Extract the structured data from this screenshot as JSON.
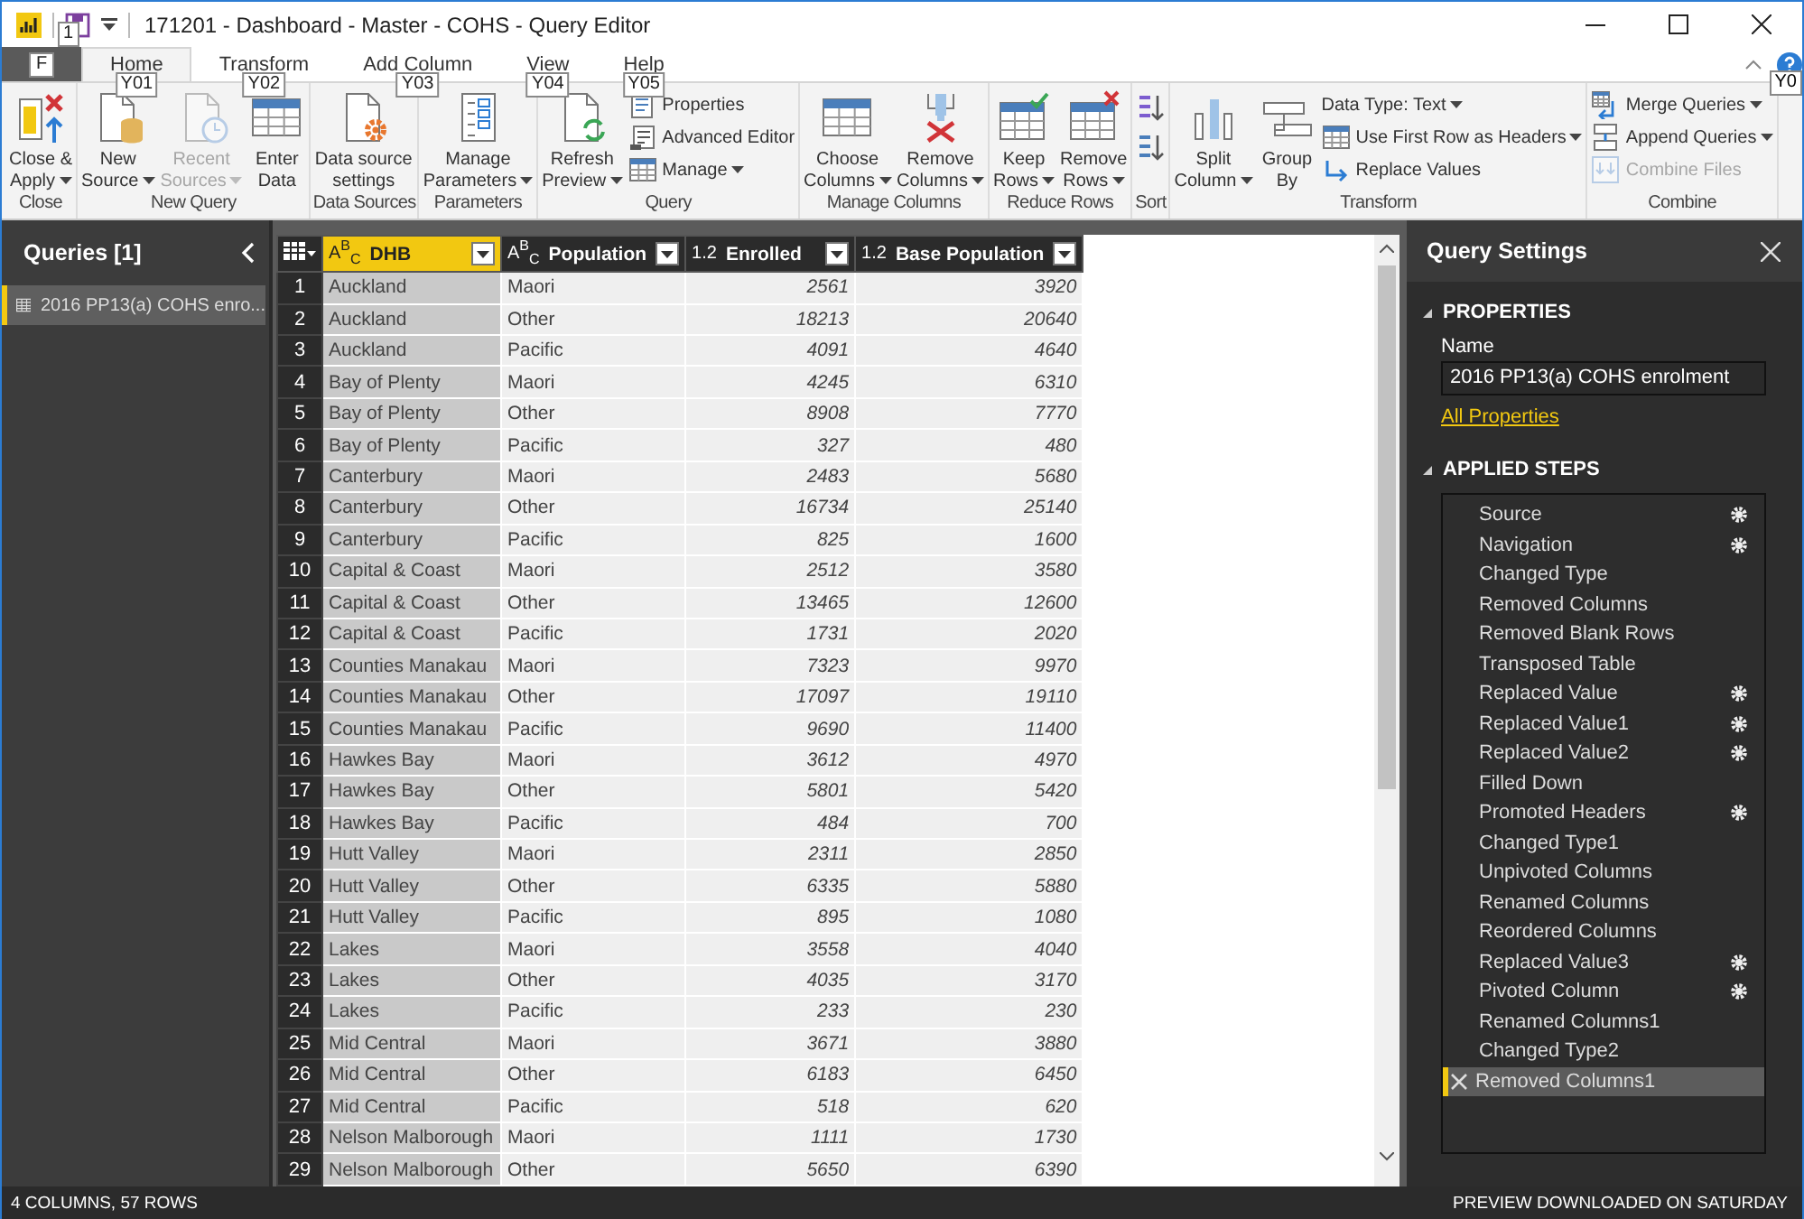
{
  "window": {
    "title": "171201 - Dashboard - Master - COHS - Query Editor",
    "save_keytip": "1"
  },
  "tabs": [
    {
      "label": "F",
      "kind": "file",
      "selected": false
    },
    {
      "label": "Home",
      "kind": "tab",
      "keytip": "Y01",
      "selected": true
    },
    {
      "label": "Transform",
      "kind": "tab",
      "keytip": "Y02",
      "selected": false
    },
    {
      "label": "Add Column",
      "kind": "tab",
      "keytip": "Y03",
      "selected": false
    },
    {
      "label": "View",
      "kind": "tab",
      "keytip": "Y04",
      "selected": false
    },
    {
      "label": "Help",
      "kind": "tab",
      "keytip": "Y05",
      "selected": false
    }
  ],
  "help_keytip": "Y0",
  "ribbon": {
    "groups": [
      {
        "label": "Close",
        "items": [
          {
            "kind": "large",
            "lines": [
              "Close &",
              "Apply"
            ],
            "dropdown": true,
            "disabled": false
          }
        ]
      },
      {
        "label": "New Query",
        "items": [
          {
            "kind": "large",
            "lines": [
              "New",
              "Source"
            ],
            "dropdown": true,
            "disabled": false
          },
          {
            "kind": "large",
            "lines": [
              "Recent",
              "Sources"
            ],
            "dropdown": true,
            "disabled": true
          },
          {
            "kind": "large",
            "lines": [
              "Enter",
              "Data"
            ],
            "dropdown": false,
            "disabled": false
          }
        ]
      },
      {
        "label": "Data Sources",
        "items": [
          {
            "kind": "large",
            "lines": [
              "Data source",
              "settings"
            ],
            "dropdown": false,
            "disabled": false
          }
        ]
      },
      {
        "label": "Parameters",
        "items": [
          {
            "kind": "large",
            "lines": [
              "Manage",
              "Parameters"
            ],
            "dropdown": true,
            "disabled": false
          }
        ]
      },
      {
        "label": "Query",
        "items": [
          {
            "kind": "large",
            "lines": [
              "Refresh",
              "Preview"
            ],
            "dropdown": true,
            "disabled": false
          },
          {
            "kind": "small",
            "lines": [
              "Properties"
            ],
            "dropdown": false,
            "disabled": false
          },
          {
            "kind": "small",
            "lines": [
              "Advanced Editor"
            ],
            "dropdown": false,
            "disabled": false
          },
          {
            "kind": "small",
            "lines": [
              "Manage"
            ],
            "dropdown": true,
            "disabled": false
          }
        ]
      },
      {
        "label": "Manage Columns",
        "items": [
          {
            "kind": "large",
            "lines": [
              "Choose",
              "Columns"
            ],
            "dropdown": true,
            "disabled": false
          },
          {
            "kind": "large",
            "lines": [
              "Remove",
              "Columns"
            ],
            "dropdown": true,
            "disabled": false
          }
        ]
      },
      {
        "label": "Reduce Rows",
        "items": [
          {
            "kind": "large",
            "lines": [
              "Keep",
              "Rows"
            ],
            "dropdown": true,
            "disabled": false
          },
          {
            "kind": "large",
            "lines": [
              "Remove",
              "Rows"
            ],
            "dropdown": true,
            "disabled": false
          }
        ]
      },
      {
        "label": "Sort",
        "items": [
          {
            "kind": "icon",
            "dropdown": false,
            "disabled": false
          },
          {
            "kind": "icon",
            "dropdown": false,
            "disabled": false
          }
        ]
      },
      {
        "label": "Transform",
        "items": [
          {
            "kind": "large",
            "lines": [
              "Split",
              "Column"
            ],
            "dropdown": true,
            "disabled": false
          },
          {
            "kind": "large",
            "lines": [
              "Group",
              "By"
            ],
            "dropdown": false,
            "disabled": false
          },
          {
            "kind": "small",
            "lines": [
              "Data Type: Text"
            ],
            "dropdown": true,
            "disabled": false
          },
          {
            "kind": "small",
            "lines": [
              "Use First Row as Headers"
            ],
            "dropdown": true,
            "disabled": false
          },
          {
            "kind": "small",
            "lines": [
              "Replace Values"
            ],
            "dropdown": false,
            "disabled": false
          }
        ]
      },
      {
        "label": "Combine",
        "items": [
          {
            "kind": "small",
            "lines": [
              "Merge Queries"
            ],
            "dropdown": true,
            "disabled": false
          },
          {
            "kind": "small",
            "lines": [
              "Append Queries"
            ],
            "dropdown": true,
            "disabled": false
          },
          {
            "kind": "small",
            "lines": [
              "Combine Files"
            ],
            "dropdown": false,
            "disabled": true
          }
        ]
      }
    ]
  },
  "queries": {
    "title": "Queries [1]",
    "items": [
      {
        "label": "2016 PP13(a) COHS enro...",
        "selected": true
      }
    ]
  },
  "table": {
    "columns": [
      {
        "type_label": "A$^{B}$$_{C}$",
        "name": "DHB",
        "kind": "text",
        "selected": true
      },
      {
        "type_label": "A$^{B}$$_{C}$",
        "name": "Population",
        "kind": "text",
        "selected": false
      },
      {
        "type_label": "1.2",
        "name": "Enrolled",
        "kind": "number",
        "selected": false
      },
      {
        "type_label": "1.2",
        "name": "Base Population",
        "kind": "number",
        "selected": false
      }
    ],
    "rows": [
      {
        "number": "1",
        "cells": [
          "Auckland",
          "Maori",
          "2561",
          "3920"
        ]
      },
      {
        "number": "2",
        "cells": [
          "Auckland",
          "Other",
          "18213",
          "20640"
        ]
      },
      {
        "number": "3",
        "cells": [
          "Auckland",
          "Pacific",
          "4091",
          "4640"
        ]
      },
      {
        "number": "4",
        "cells": [
          "Bay of Plenty",
          "Maori",
          "4245",
          "6310"
        ]
      },
      {
        "number": "5",
        "cells": [
          "Bay of Plenty",
          "Other",
          "8908",
          "7770"
        ]
      },
      {
        "number": "6",
        "cells": [
          "Bay of Plenty",
          "Pacific",
          "327",
          "480"
        ]
      },
      {
        "number": "7",
        "cells": [
          "Canterbury",
          "Maori",
          "2483",
          "5680"
        ]
      },
      {
        "number": "8",
        "cells": [
          "Canterbury",
          "Other",
          "16734",
          "25140"
        ]
      },
      {
        "number": "9",
        "cells": [
          "Canterbury",
          "Pacific",
          "825",
          "1600"
        ]
      },
      {
        "number": "10",
        "cells": [
          "Capital & Coast",
          "Maori",
          "2512",
          "3580"
        ]
      },
      {
        "number": "11",
        "cells": [
          "Capital & Coast",
          "Other",
          "13465",
          "12600"
        ]
      },
      {
        "number": "12",
        "cells": [
          "Capital & Coast",
          "Pacific",
          "1731",
          "2020"
        ]
      },
      {
        "number": "13",
        "cells": [
          "Counties Manakau",
          "Maori",
          "7323",
          "9970"
        ]
      },
      {
        "number": "14",
        "cells": [
          "Counties Manakau",
          "Other",
          "17097",
          "19110"
        ]
      },
      {
        "number": "15",
        "cells": [
          "Counties Manakau",
          "Pacific",
          "9690",
          "11400"
        ]
      },
      {
        "number": "16",
        "cells": [
          "Hawkes Bay",
          "Maori",
          "3612",
          "4970"
        ]
      },
      {
        "number": "17",
        "cells": [
          "Hawkes Bay",
          "Other",
          "5801",
          "5420"
        ]
      },
      {
        "number": "18",
        "cells": [
          "Hawkes Bay",
          "Pacific",
          "484",
          "700"
        ]
      },
      {
        "number": "19",
        "cells": [
          "Hutt Valley",
          "Maori",
          "2311",
          "2850"
        ]
      },
      {
        "number": "20",
        "cells": [
          "Hutt Valley",
          "Other",
          "6335",
          "5880"
        ]
      },
      {
        "number": "21",
        "cells": [
          "Hutt Valley",
          "Pacific",
          "895",
          "1080"
        ]
      },
      {
        "number": "22",
        "cells": [
          "Lakes",
          "Maori",
          "3558",
          "4040"
        ]
      },
      {
        "number": "23",
        "cells": [
          "Lakes",
          "Other",
          "4035",
          "3170"
        ]
      },
      {
        "number": "24",
        "cells": [
          "Lakes",
          "Pacific",
          "233",
          "230"
        ]
      },
      {
        "number": "25",
        "cells": [
          "Mid Central",
          "Maori",
          "3671",
          "3880"
        ]
      },
      {
        "number": "26",
        "cells": [
          "Mid Central",
          "Other",
          "6183",
          "6450"
        ]
      },
      {
        "number": "27",
        "cells": [
          "Mid Central",
          "Pacific",
          "518",
          "620"
        ]
      },
      {
        "number": "28",
        "cells": [
          "Nelson Malborough",
          "Maori",
          "1111",
          "1730"
        ]
      },
      {
        "number": "29",
        "cells": [
          "Nelson Malborough",
          "Other",
          "5650",
          "6390"
        ]
      }
    ]
  },
  "query_settings": {
    "title": "Query Settings",
    "properties_heading": "PROPERTIES",
    "name_label": "Name",
    "name_value": "2016 PP13(a) COHS enrolment",
    "all_properties_link": "All Properties",
    "steps_heading": "APPLIED STEPS",
    "steps": [
      {
        "label": "Source",
        "settings": true,
        "selected": false
      },
      {
        "label": "Navigation",
        "settings": true,
        "selected": false
      },
      {
        "label": "Changed Type",
        "settings": false,
        "selected": false
      },
      {
        "label": "Removed Columns",
        "settings": false,
        "selected": false
      },
      {
        "label": "Removed Blank Rows",
        "settings": false,
        "selected": false
      },
      {
        "label": "Transposed Table",
        "settings": false,
        "selected": false
      },
      {
        "label": "Replaced Value",
        "settings": true,
        "selected": false
      },
      {
        "label": "Replaced Value1",
        "settings": true,
        "selected": false
      },
      {
        "label": "Replaced Value2",
        "settings": true,
        "selected": false
      },
      {
        "label": "Filled Down",
        "settings": false,
        "selected": false
      },
      {
        "label": "Promoted Headers",
        "settings": true,
        "selected": false
      },
      {
        "label": "Changed Type1",
        "settings": false,
        "selected": false
      },
      {
        "label": "Unpivoted Columns",
        "settings": false,
        "selected": false
      },
      {
        "label": "Renamed Columns",
        "settings": false,
        "selected": false
      },
      {
        "label": "Reordered Columns",
        "settings": false,
        "selected": false
      },
      {
        "label": "Replaced Value3",
        "settings": true,
        "selected": false
      },
      {
        "label": "Pivoted Column",
        "settings": true,
        "selected": false
      },
      {
        "label": "Renamed Columns1",
        "settings": false,
        "selected": false
      },
      {
        "label": "Changed Type2",
        "settings": false,
        "selected": false
      },
      {
        "label": "Removed Columns1",
        "settings": false,
        "selected": true
      }
    ]
  },
  "status_bar": {
    "left": "4 COLUMNS, 57 ROWS",
    "right": "PREVIEW DOWNLOADED ON SATURDAY"
  }
}
